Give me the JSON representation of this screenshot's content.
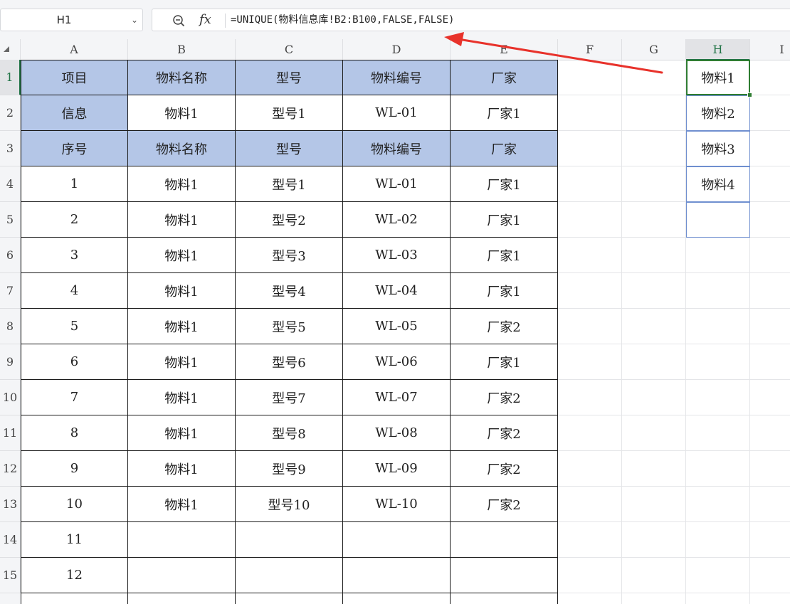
{
  "formula_bar": {
    "name_box": "H1",
    "formula": "=UNIQUE(物料信息库!B2:B100,FALSE,FALSE)",
    "fx_label": "fx",
    "icons": {
      "zoom": "zoom-out-icon",
      "dropdown": "chevron-down-icon"
    }
  },
  "columns": [
    "A",
    "B",
    "C",
    "D",
    "E",
    "F",
    "G",
    "H",
    "I"
  ],
  "active_column": "H",
  "rows": [
    "1",
    "2",
    "3",
    "4",
    "5",
    "6",
    "7",
    "8",
    "9",
    "10",
    "11",
    "12",
    "13",
    "14",
    "15"
  ],
  "active_row": "1",
  "table": {
    "header_rows": [
      [
        "项目",
        "物料名称",
        "型号",
        "物料编号",
        "厂家"
      ],
      [
        "信息",
        "物料1",
        "型号1",
        "WL-01",
        "厂家1"
      ],
      [
        "序号",
        "物料名称",
        "型号",
        "物料编号",
        "厂家"
      ]
    ],
    "data_rows": [
      [
        "1",
        "物料1",
        "型号1",
        "WL-01",
        "厂家1"
      ],
      [
        "2",
        "物料1",
        "型号2",
        "WL-02",
        "厂家1"
      ],
      [
        "3",
        "物料1",
        "型号3",
        "WL-03",
        "厂家1"
      ],
      [
        "4",
        "物料1",
        "型号4",
        "WL-04",
        "厂家1"
      ],
      [
        "5",
        "物料1",
        "型号5",
        "WL-05",
        "厂家2"
      ],
      [
        "6",
        "物料1",
        "型号6",
        "WL-06",
        "厂家1"
      ],
      [
        "7",
        "物料1",
        "型号7",
        "WL-07",
        "厂家2"
      ],
      [
        "8",
        "物料1",
        "型号8",
        "WL-08",
        "厂家2"
      ],
      [
        "9",
        "物料1",
        "型号9",
        "WL-09",
        "厂家2"
      ],
      [
        "10",
        "物料1",
        "型号10",
        "WL-10",
        "厂家2"
      ],
      [
        "11",
        "",
        "",
        "",
        ""
      ],
      [
        "12",
        "",
        "",
        "",
        ""
      ],
      [
        "",
        "",
        "",
        "",
        ""
      ]
    ]
  },
  "spill_column": {
    "column": "H",
    "values": [
      "物料1",
      "物料2",
      "物料3",
      "物料4",
      ""
    ]
  },
  "colors": {
    "header_fill": "#b4c6e7",
    "selection": "#2f7d32",
    "spill_border": "#6f8fcf",
    "arrow": "#e8322b"
  }
}
